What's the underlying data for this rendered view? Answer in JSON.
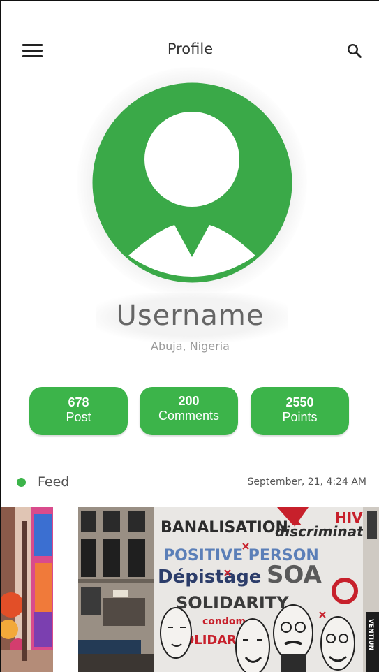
{
  "header": {
    "title": "Profile",
    "menu_icon": "hamburger-menu-icon",
    "search_icon": "search-icon"
  },
  "profile": {
    "avatar_icon": "user-avatar-icon",
    "username": "Username",
    "location": "Abuja, Nigeria"
  },
  "stats": [
    {
      "value": "678",
      "label": "Post"
    },
    {
      "value": "200",
      "label": "Comments"
    },
    {
      "value": "2550",
      "label": "Points"
    }
  ],
  "feed": {
    "label": "Feed",
    "timestamp": "September, 21,  4:24 AM",
    "mural_words": [
      "BANALISATION",
      "discriminat",
      "HIV",
      "POSITIVE PERSON",
      "Dépistage",
      "SOA",
      "SOLIDARITY",
      "condom",
      "SOLIDARITÉ",
      "VENTIUN"
    ]
  },
  "colors": {
    "accent": "#3cb44a",
    "title_text": "#333333",
    "username_text": "#666666",
    "muted_text": "#9a9a9a"
  }
}
